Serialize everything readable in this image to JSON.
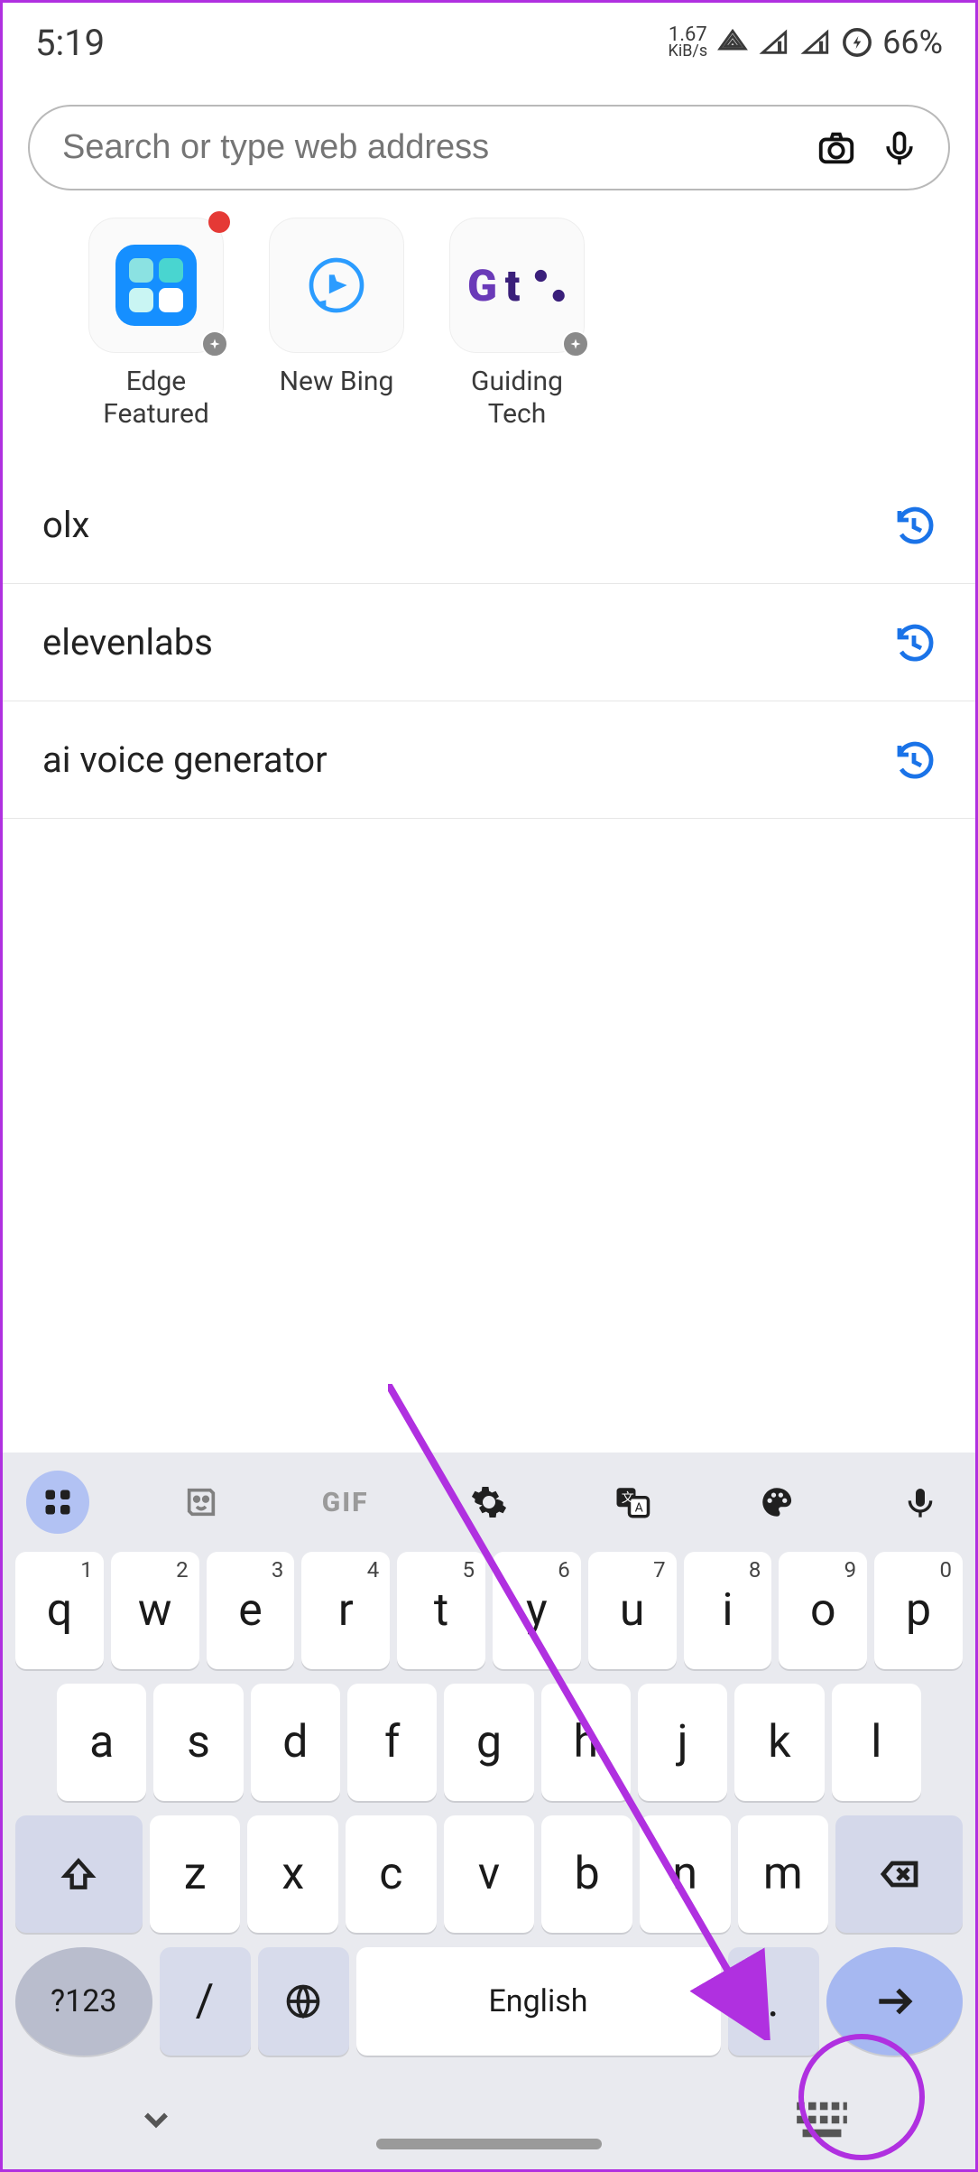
{
  "status": {
    "time": "5:19",
    "speed_top": "1.67",
    "speed_bottom": "KiB/s",
    "battery": "66%"
  },
  "search": {
    "placeholder": "Search or type web address"
  },
  "tiles": [
    {
      "label_line1": "Edge",
      "label_line2": "Featured"
    },
    {
      "label_line1": "New Bing",
      "label_line2": ""
    },
    {
      "label_line1": "Guiding",
      "label_line2": "Tech"
    }
  ],
  "history": [
    {
      "text": "olx"
    },
    {
      "text": "elevenlabs"
    },
    {
      "text": "ai voice generator"
    }
  ],
  "keyboard": {
    "tools_gif": "GIF",
    "row1": [
      "q",
      "w",
      "e",
      "r",
      "t",
      "y",
      "u",
      "i",
      "o",
      "p"
    ],
    "row1_nums": [
      "1",
      "2",
      "3",
      "4",
      "5",
      "6",
      "7",
      "8",
      "9",
      "0"
    ],
    "row2": [
      "a",
      "s",
      "d",
      "f",
      "g",
      "h",
      "j",
      "k",
      "l"
    ],
    "row3": [
      "z",
      "x",
      "c",
      "v",
      "b",
      "n",
      "m"
    ],
    "sym": "?123",
    "slash": "/",
    "space": "English",
    "dot": "."
  }
}
